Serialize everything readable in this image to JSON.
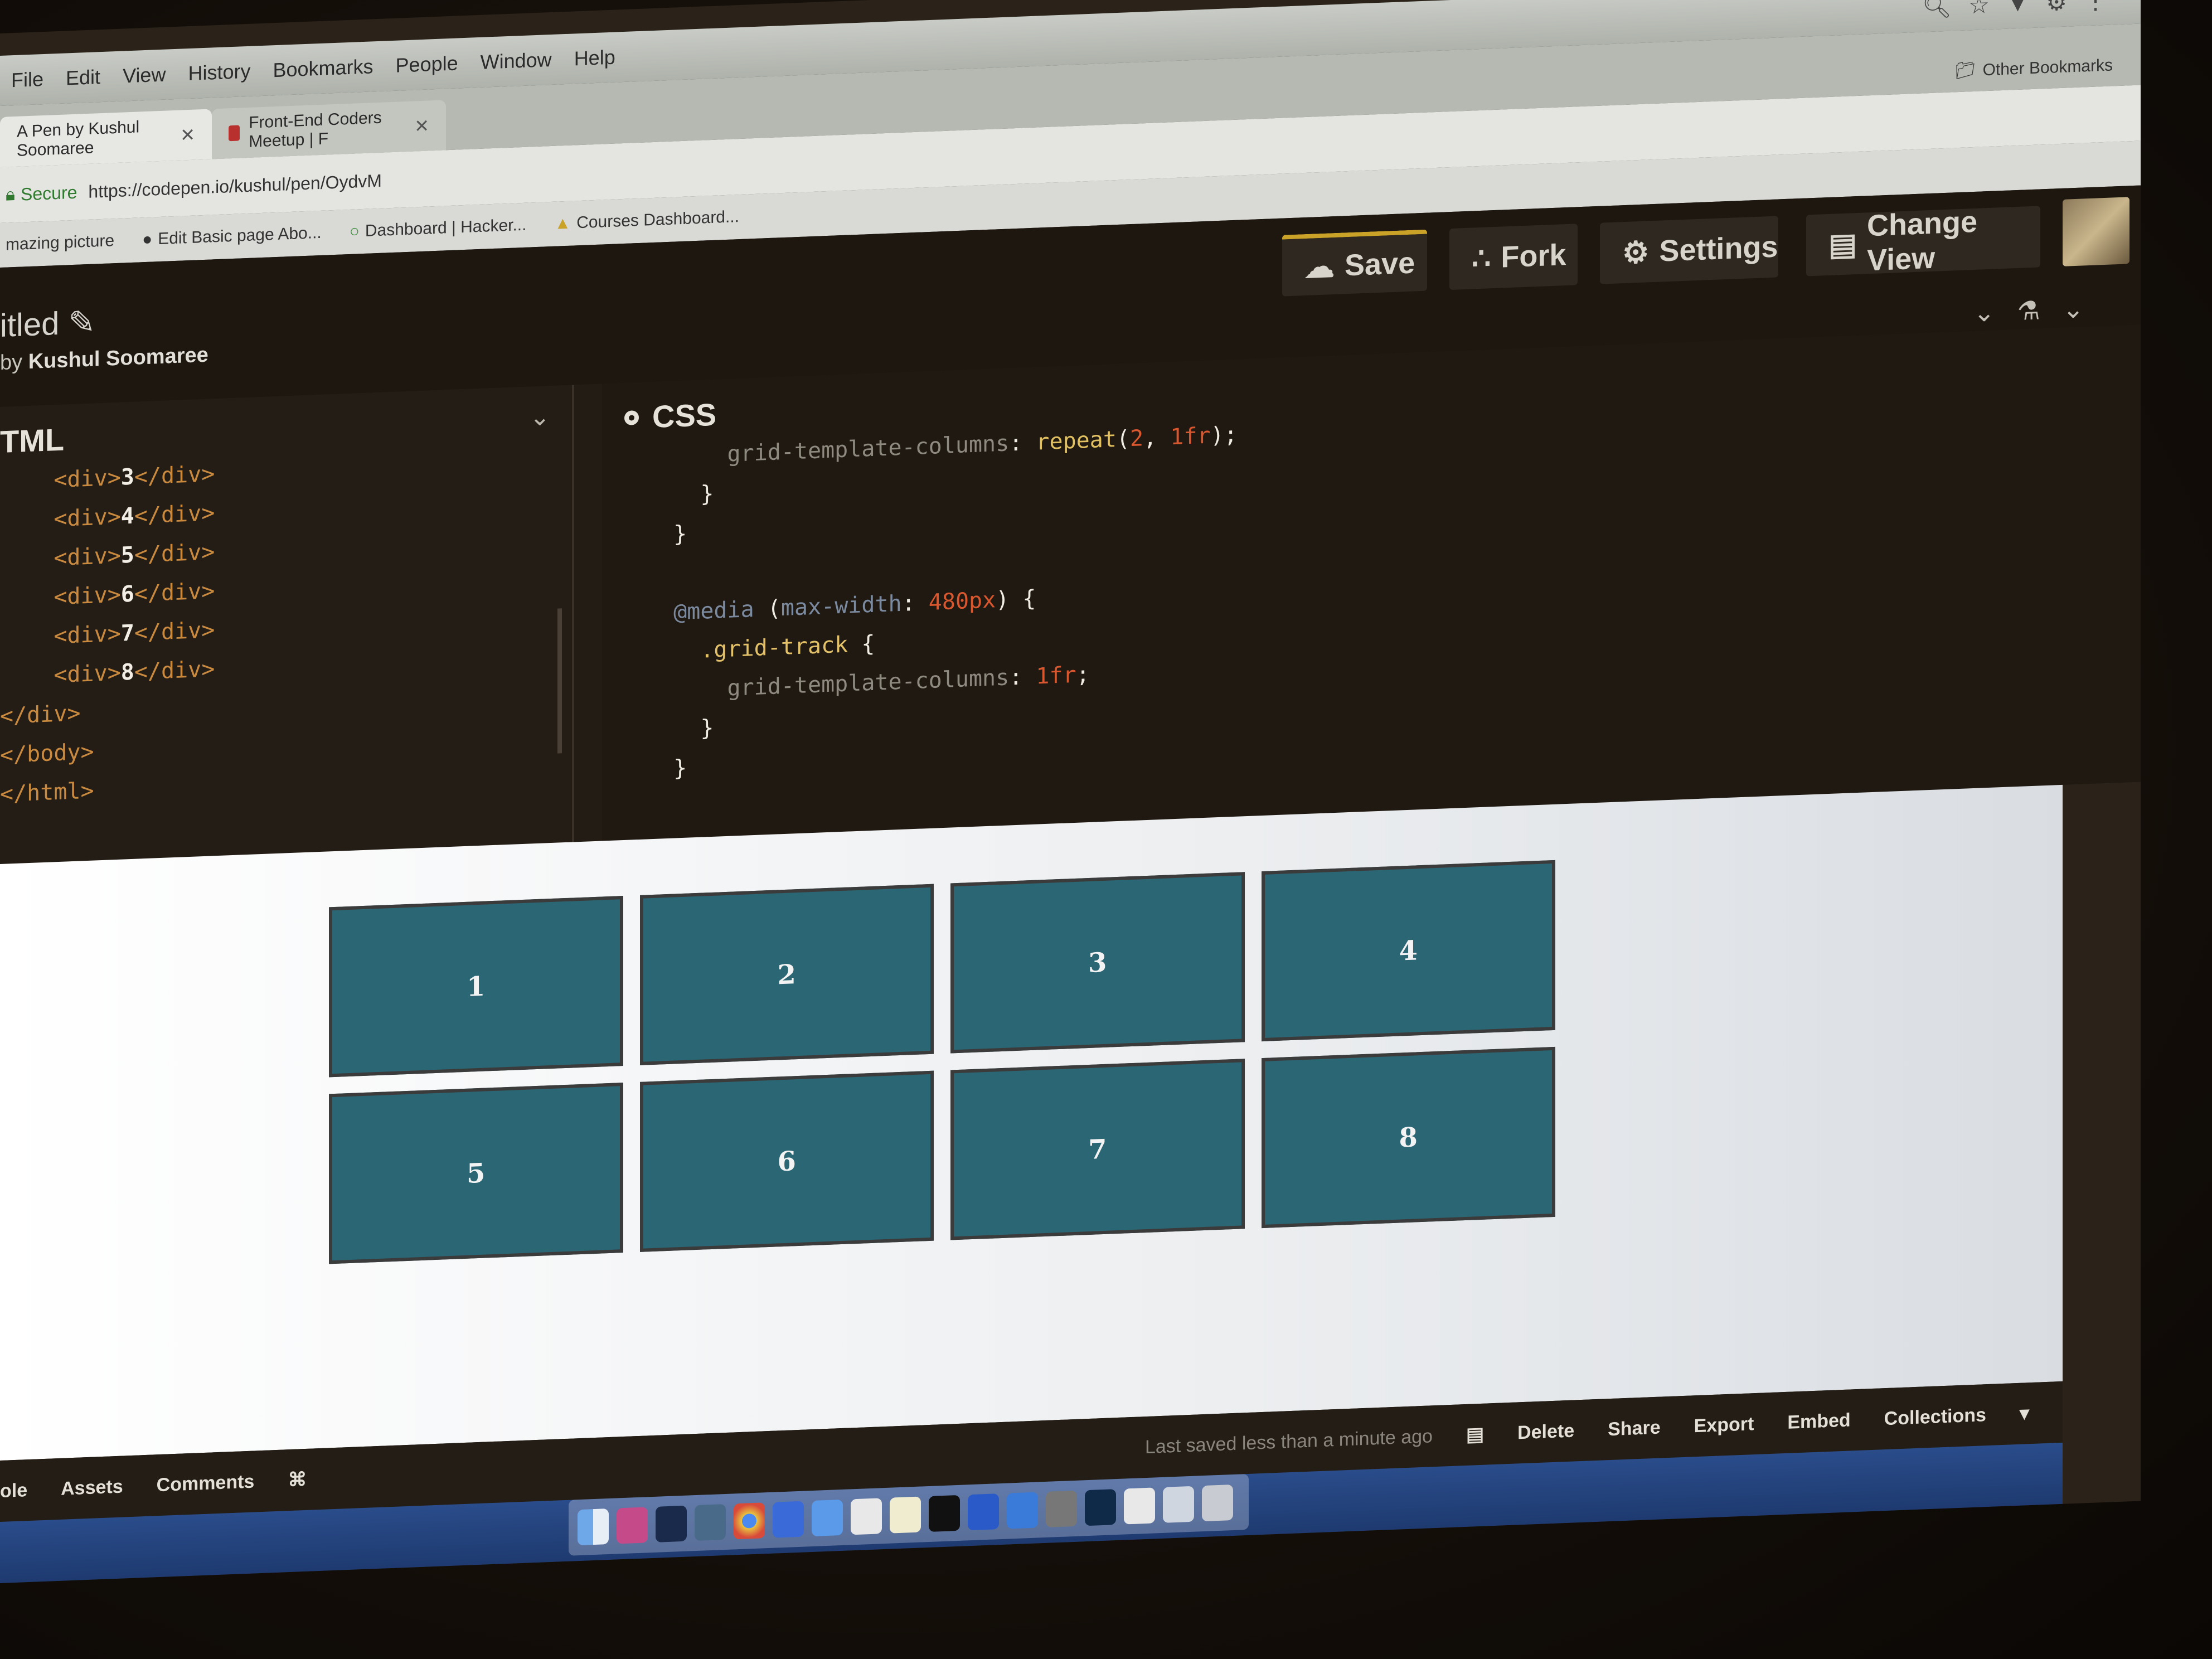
{
  "browser": {
    "menu": [
      "File",
      "Edit",
      "View",
      "History",
      "Bookmarks",
      "People",
      "Window",
      "Help"
    ],
    "tabs": [
      {
        "label": "A Pen by Kushul Soomaree"
      },
      {
        "label": "Front-End Coders Meetup | F"
      }
    ],
    "other_bookmarks": "Other Bookmarks",
    "address": {
      "secure": "Secure",
      "url": "https://codepen.io/kushul/pen/OydvM"
    },
    "bookmarks": [
      "mazing picture",
      "Edit Basic page Abo...",
      "Dashboard | Hacker...",
      "Courses Dashboard..."
    ]
  },
  "codepen": {
    "title": "itled",
    "author_prefix": "by",
    "author": "Kushul Soomaree",
    "buttons": {
      "save": "Save",
      "fork": "Fork",
      "settings": "Settings",
      "change_view": "Change View"
    }
  },
  "html_editor": {
    "title": "TML",
    "lines": [
      "3",
      "4",
      "5",
      "6",
      "7",
      "8"
    ],
    "close_div": "</div>",
    "close_body": "</body>",
    "close_html": "</html>"
  },
  "css_editor": {
    "title": "CSS",
    "line1_prop": "grid-template-columns",
    "line1_fn": "repeat",
    "line1_arg1": "2",
    "line1_arg2": "1fr",
    "media_kw": "@media",
    "media_prop": "max-width",
    "media_val": "480px",
    "selector": ".grid-track",
    "line2_prop": "grid-template-columns",
    "line2_val": "1fr"
  },
  "preview": {
    "cells": [
      "1",
      "2",
      "3",
      "4",
      "5",
      "6",
      "7",
      "8"
    ],
    "cell_color": "#2b6674"
  },
  "bottom_bar": {
    "left": [
      "ole",
      "Assets",
      "Comments"
    ],
    "last_saved": "Last saved less than a minute ago",
    "actions": [
      "Delete",
      "Share",
      "Export",
      "Embed",
      "Collections"
    ]
  },
  "colors": {
    "save_accent": "#c9a227",
    "editor_bg": "#1f1912",
    "tag": "#c98a3f",
    "value": "#d9572f"
  }
}
